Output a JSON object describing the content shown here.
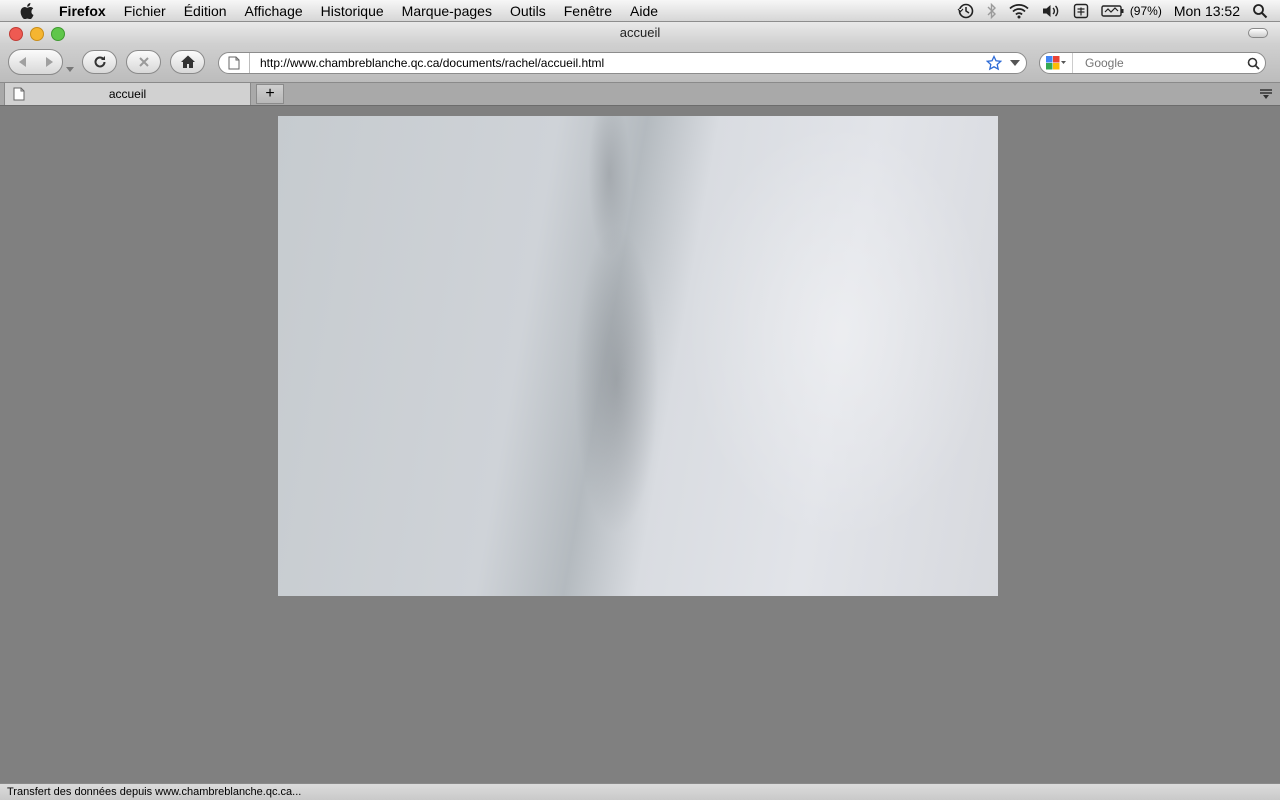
{
  "menubar": {
    "app_name": "Firefox",
    "items": [
      "Fichier",
      "Édition",
      "Affichage",
      "Historique",
      "Marque-pages",
      "Outils",
      "Fenêtre",
      "Aide"
    ],
    "battery": "(97%)",
    "clock": "Mon 13:52"
  },
  "window": {
    "title": "accueil",
    "traffic_light_colors": [
      "#ee5a52",
      "#f5b531",
      "#5fc64a"
    ]
  },
  "toolbar": {
    "url": "http://www.chambreblanche.qc.ca/documents/rachel/accueil.html",
    "search_placeholder": "Google"
  },
  "tabs": [
    {
      "label": "accueil",
      "active": true
    }
  ],
  "new_tab_label": "+",
  "content": {
    "background_color": "#808080",
    "image_subject": "white bedsheet photo"
  },
  "status_bar": {
    "text": "Transfert des données depuis www.chambreblanche.qc.ca..."
  }
}
